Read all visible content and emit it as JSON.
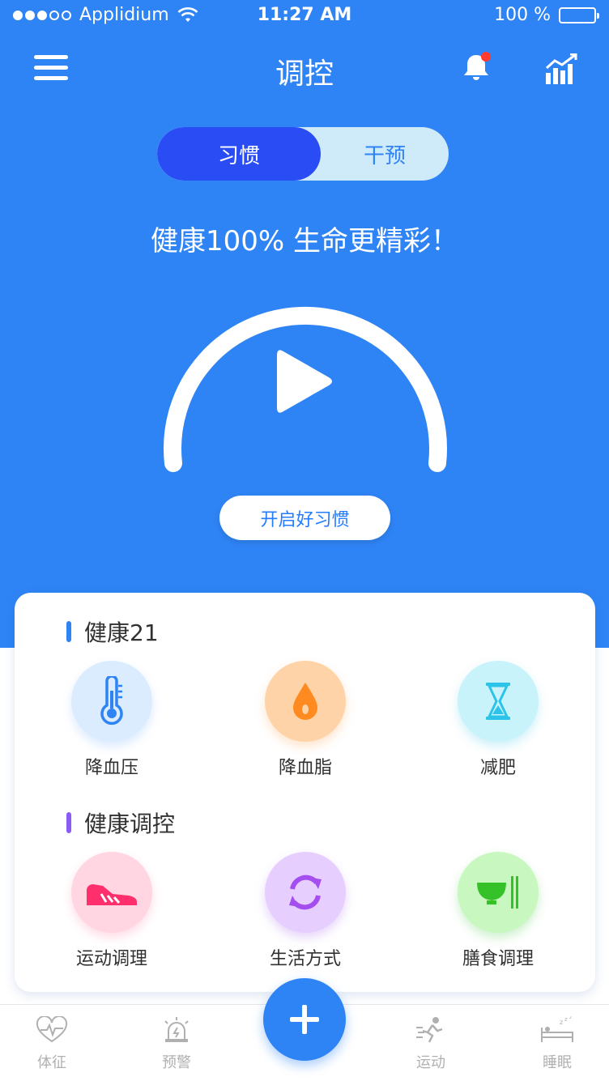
{
  "status_bar": {
    "carrier": "Applidium",
    "time": "11:27 AM",
    "battery": "100 %"
  },
  "header": {
    "title": "调控"
  },
  "segment": {
    "active_label": "习惯",
    "inactive_label": "干预"
  },
  "hero": {
    "slogan": "健康100%   生命更精彩！",
    "start_button": "开启好习惯"
  },
  "card": {
    "section1": {
      "title": "健康21",
      "items": [
        {
          "label": "降血压"
        },
        {
          "label": "降血脂"
        },
        {
          "label": "减肥"
        }
      ]
    },
    "section2": {
      "title": "健康调控",
      "items": [
        {
          "label": "运动调理"
        },
        {
          "label": "生活方式"
        },
        {
          "label": "膳食调理"
        }
      ]
    }
  },
  "tabbar": {
    "items": [
      {
        "label": "体征"
      },
      {
        "label": "预警"
      },
      {
        "label": "运动"
      },
      {
        "label": "睡眠"
      }
    ]
  },
  "colors": {
    "primary": "#2f84f5",
    "segment_active": "#2a4cf5",
    "text_dark": "#313131",
    "button_text": "#257cff",
    "notification_dot": "#ff3b30"
  }
}
